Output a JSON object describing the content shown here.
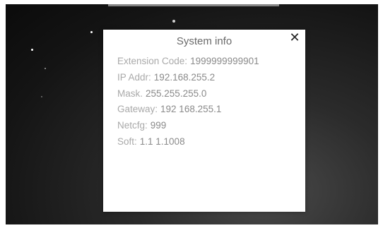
{
  "dialog": {
    "title": "System info",
    "close_icon": "close-icon",
    "close_glyph": "✕",
    "rows": [
      {
        "label": "Extension Code:",
        "value": "1999999999901"
      },
      {
        "label": "IP Addr:",
        "value": "192.168.255.2"
      },
      {
        "label": "Mask.",
        "value": "255.255.255.0"
      },
      {
        "label": "Gateway:",
        "value": "192 168.255.1"
      },
      {
        "label": "Netcfg:",
        "value": "999"
      },
      {
        "label": "Soft:",
        "value": "1.1 1.1008"
      }
    ]
  },
  "colors": {
    "background": "#141414",
    "dialog_bg": "#ffffff",
    "text": "#8f8f8f",
    "close": "#222222"
  }
}
